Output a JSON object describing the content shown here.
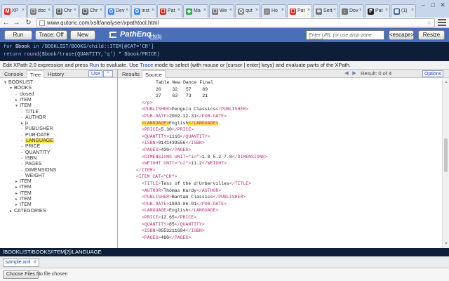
{
  "browser": {
    "tabs": [
      {
        "label": "XP",
        "icon": "gmail-icon",
        "color": "#d93025",
        "letter": "M"
      },
      {
        "label": "doc",
        "icon": "doc-icon",
        "color": "#777777",
        "letter": "☐"
      },
      {
        "label": "Chr",
        "icon": "chrome-icon",
        "color": "#666666",
        "letter": "☐"
      },
      {
        "label": "Chr",
        "icon": "chrome-icon",
        "color": "#666666",
        "letter": "☐"
      },
      {
        "label": "Dev",
        "icon": "google-icon",
        "color": "#4285f4",
        "letter": "G"
      },
      {
        "label": "inst",
        "icon": "google-icon",
        "color": "#4285f4",
        "letter": "G"
      },
      {
        "label": "Pat",
        "icon": "qutoric-icon",
        "color": "#c3302c",
        "letter": "☐"
      },
      {
        "label": "Ma",
        "icon": "maps-icon",
        "color": "#34a853",
        "letter": "◈"
      },
      {
        "label": "We",
        "icon": "doc-icon",
        "color": "#777777",
        "letter": "☐"
      },
      {
        "label": "qut",
        "icon": "search-icon",
        "color": "#888888",
        "letter": "Q"
      },
      {
        "label": "Ho",
        "icon": "home-icon",
        "color": "#888888",
        "letter": "⌂"
      },
      {
        "label": "Pat",
        "icon": "qutoric-icon",
        "color": "#c3302c",
        "letter": "☐"
      },
      {
        "label": "Sett",
        "icon": "settings-icon",
        "color": "#777777",
        "letter": "✲"
      },
      {
        "label": "Dov",
        "icon": "download-icon",
        "color": "#777777",
        "letter": "↓"
      },
      {
        "label": "Pat",
        "icon": "qutoric-icon",
        "color": "#222222",
        "letter": "P"
      },
      {
        "label": "(1)",
        "icon": "grid-icon",
        "color": "#3b5998",
        "letter": "▦"
      }
    ],
    "active_tab_index": 11,
    "url": "www.qutoric.com/xslt/analyser/xpathtool.html"
  },
  "app": {
    "run_label": "Run",
    "trace_label": "Trace: Off",
    "new_label": "New",
    "logo_text": "PathEnq",
    "help_label": "Help",
    "url_placeholder": "Enter URL (or use drop-zone below)",
    "escape_label": "<escape>",
    "resize_label": "Resize"
  },
  "xpath": {
    "line1": [
      {
        "t": "for ",
        "c": "kw"
      },
      {
        "t": "$book",
        "c": "var"
      },
      {
        "t": " in ",
        "c": "kw"
      },
      {
        "t": "/BOOKLIST/BOOKS/child::ITEM[@CAT='CR']",
        "c": "path"
      }
    ],
    "line2": [
      {
        "t": "return ",
        "c": "kw"
      },
      {
        "t": "round(",
        "c": "fn"
      },
      {
        "t": "$book/trace(QUANTITY,'q')",
        "c": "path"
      },
      {
        "t": " * ",
        "c": "var"
      },
      {
        "t": "$book/PRICE",
        "c": "path"
      },
      {
        "t": ")",
        "c": "fn"
      }
    ]
  },
  "status": {
    "pre": "Edit XPath 2.0 expression and press ",
    "run": "Run",
    "mid": " to evaluate. Use ",
    "trace": "Trace",
    "post": " mode to select (with mouse or [cursor | enter] keys) and evaluate parts of the XPath."
  },
  "left": {
    "tabs": [
      "Console",
      "Tree",
      "History"
    ],
    "selected_tab": 1,
    "use_label": "Use",
    "collapse_label": "⌃",
    "tree": [
      {
        "depth": 0,
        "tw": "▾",
        "label": "BOOKLIST"
      },
      {
        "depth": 1,
        "tw": "▾",
        "label": "BOOKS"
      },
      {
        "depth": 2,
        "tw": "-",
        "label": "closed"
      },
      {
        "depth": 2,
        "tw": "▸",
        "label": "ITEM"
      },
      {
        "depth": 2,
        "tw": "▾",
        "label": "ITEM"
      },
      {
        "depth": 3,
        "tw": "-",
        "label": "TITLE"
      },
      {
        "depth": 3,
        "tw": "-",
        "label": "AUTHOR"
      },
      {
        "depth": 3,
        "tw": "▸",
        "label": "p"
      },
      {
        "depth": 3,
        "tw": "-",
        "label": "PUBLISHER"
      },
      {
        "depth": 3,
        "tw": "-",
        "label": "PUB-DATE"
      },
      {
        "depth": 3,
        "tw": "-",
        "label": "LANGUAGE",
        "hl": true
      },
      {
        "depth": 3,
        "tw": "-",
        "label": "PRICE"
      },
      {
        "depth": 3,
        "tw": "-",
        "label": "QUANTITY"
      },
      {
        "depth": 3,
        "tw": "-",
        "label": "ISBN"
      },
      {
        "depth": 3,
        "tw": "-",
        "label": "PAGES"
      },
      {
        "depth": 3,
        "tw": "-",
        "label": "DIMENSIONS"
      },
      {
        "depth": 3,
        "tw": "-",
        "label": "WEIGHT"
      },
      {
        "depth": 2,
        "tw": "▸",
        "label": "ITEM"
      },
      {
        "depth": 2,
        "tw": "▸",
        "label": "ITEM"
      },
      {
        "depth": 2,
        "tw": "▸",
        "label": "ITEM"
      },
      {
        "depth": 2,
        "tw": "▸",
        "label": "ITEM"
      },
      {
        "depth": 2,
        "tw": "▸",
        "label": "ITEM"
      },
      {
        "depth": 1,
        "tw": "▸",
        "label": "CATEGORIES"
      }
    ]
  },
  "right": {
    "tabs": [
      "Results",
      "Source"
    ],
    "selected_tab": 1,
    "result_text": "Result: 0 of 4",
    "options_label": "Options",
    "lines": [
      {
        "indent": 9,
        "parts": [
          {
            "t": "Table New Dance Final"
          }
        ]
      },
      {
        "indent": 9,
        "parts": [
          {
            "t": "20    32   57    89"
          }
        ]
      },
      {
        "indent": 9,
        "parts": [
          {
            "t": "27    63   73    21"
          }
        ]
      },
      {
        "indent": 4,
        "parts": [
          {
            "t": "</p>",
            "c": "tg"
          }
        ]
      },
      {
        "indent": 4,
        "parts": [
          {
            "t": "<PUBLISHER>",
            "c": "tg"
          },
          {
            "t": "Penguin Classics"
          },
          {
            "t": "</PUBLISHER>",
            "c": "tg"
          }
        ]
      },
      {
        "indent": 4,
        "parts": [
          {
            "t": "<PUB-DATE>",
            "c": "tg"
          },
          {
            "t": "2002-12-31"
          },
          {
            "t": "</PUB-DATE>",
            "c": "tg"
          }
        ]
      },
      {
        "indent": 4,
        "hl": true,
        "parts": [
          {
            "t": "<LANGUAGE>",
            "c": "tg lang"
          },
          {
            "t": "English"
          },
          {
            "t": "</LANGUAGE>",
            "c": "tg lang"
          }
        ]
      },
      {
        "indent": 4,
        "parts": [
          {
            "t": "<PRICE>",
            "c": "tg"
          },
          {
            "t": "5.30"
          },
          {
            "t": "</PRICE>",
            "c": "tg"
          }
        ]
      },
      {
        "indent": 4,
        "parts": [
          {
            "t": "<QUANTITY>",
            "c": "tg"
          },
          {
            "t": "1116"
          },
          {
            "t": "</QUANTITY>",
            "c": "tg"
          }
        ]
      },
      {
        "indent": 4,
        "parts": [
          {
            "t": "<ISBN>",
            "c": "tg"
          },
          {
            "t": "0141439556"
          },
          {
            "t": "</ISBN>",
            "c": "tg"
          }
        ]
      },
      {
        "indent": 4,
        "parts": [
          {
            "t": "<PAGES>",
            "c": "tg"
          },
          {
            "t": "430"
          },
          {
            "t": "</PAGES>",
            "c": "tg"
          }
        ]
      },
      {
        "indent": 4,
        "parts": [
          {
            "t": "<DIMENSIONS UNIT=\"in\">",
            "c": "tg"
          },
          {
            "t": "1.0 5.2 7.8"
          },
          {
            "t": "</DIMENSIONS>",
            "c": "tg"
          }
        ]
      },
      {
        "indent": 4,
        "parts": [
          {
            "t": "<WEIGHT UNIT=\"oz\">",
            "c": "tg"
          },
          {
            "t": "11.2"
          },
          {
            "t": "</WEIGHT>",
            "c": "tg"
          }
        ]
      },
      {
        "indent": 2,
        "parts": [
          {
            "t": "</ITEM>",
            "c": "tg"
          }
        ]
      },
      {
        "indent": 2,
        "parts": [
          {
            "t": "<ITEM CAT=\"CR\">",
            "c": "tg"
          }
        ]
      },
      {
        "indent": 4,
        "parts": [
          {
            "t": "<TITLE>",
            "c": "tg"
          },
          {
            "t": "Tess of the d'Urbervilles"
          },
          {
            "t": "</TITLE>",
            "c": "tg"
          }
        ]
      },
      {
        "indent": 4,
        "parts": [
          {
            "t": "<AUTHOR>",
            "c": "tg"
          },
          {
            "t": "Thomas Hardy"
          },
          {
            "t": "</AUTHOR>",
            "c": "tg"
          }
        ]
      },
      {
        "indent": 4,
        "parts": [
          {
            "t": "<PUBLISHER>",
            "c": "tg"
          },
          {
            "t": "Bantam Classics"
          },
          {
            "t": "</PUBLISHER>",
            "c": "tg"
          }
        ]
      },
      {
        "indent": 4,
        "parts": [
          {
            "t": "<PUB-DATE>",
            "c": "tg"
          },
          {
            "t": "1984-06-01"
          },
          {
            "t": "</PUB-DATE>",
            "c": "tg"
          }
        ]
      },
      {
        "indent": 4,
        "parts": [
          {
            "t": "<LANGUAGE>",
            "c": "tg"
          },
          {
            "t": "English"
          },
          {
            "t": "</LANGUAGE>",
            "c": "tg"
          }
        ]
      },
      {
        "indent": 4,
        "parts": [
          {
            "t": "<PRICE>",
            "c": "tg"
          },
          {
            "t": "12.65"
          },
          {
            "t": "</PRICE>",
            "c": "tg"
          }
        ]
      },
      {
        "indent": 4,
        "parts": [
          {
            "t": "<QUANTITY>",
            "c": "tg"
          },
          {
            "t": "85"
          },
          {
            "t": "</QUANTITY>",
            "c": "tg"
          }
        ]
      },
      {
        "indent": 4,
        "parts": [
          {
            "t": "<ISBN>",
            "c": "tg"
          },
          {
            "t": "0553211684"
          },
          {
            "t": "</ISBN>",
            "c": "tg"
          }
        ]
      },
      {
        "indent": 4,
        "parts": [
          {
            "t": "<PAGES>",
            "c": "tg"
          },
          {
            "t": "480"
          },
          {
            "t": "</PAGES>",
            "c": "tg"
          }
        ]
      }
    ]
  },
  "bottom": {
    "path": "/BOOKLIST/BOOKS/ITEM[2]/LANGUAGE",
    "file_tab": "sample.xml",
    "file_close": "X",
    "choose_label": "Choose Files",
    "no_file": "No file chosen"
  },
  "colors": {
    "appbar": "#4a6fb6",
    "editor_bg": "#0c1e3a",
    "highlight": "#ffe64d",
    "tag": "#b0307a"
  }
}
